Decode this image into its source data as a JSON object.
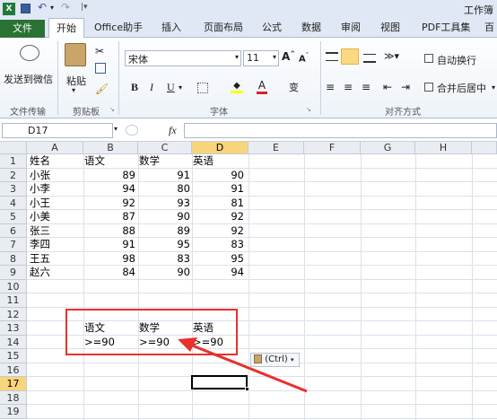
{
  "window": {
    "title": "工作簿"
  },
  "tabs": {
    "file": "文件",
    "home": "开始",
    "office": "Office助手",
    "insert": "插入",
    "layout": "页面布局",
    "formula": "公式",
    "data": "数据",
    "review": "审阅",
    "view": "视图",
    "pdf": "PDF工具集",
    "more": "百"
  },
  "ribbon": {
    "send_wechat": "发送到微信",
    "paste": "粘贴",
    "font_name": "宋体",
    "font_size": "11",
    "bold": "B",
    "italic": "I",
    "underline": "U",
    "wrap": "自动换行",
    "merge": "合并后居中",
    "groups": {
      "file_transfer": "文件传输",
      "clipboard": "剪贴板",
      "font": "字体",
      "alignment": "对齐方式"
    }
  },
  "formula_bar": {
    "name_box": "D17",
    "fx": "fx",
    "value": ""
  },
  "columns": [
    "A",
    "B",
    "C",
    "D",
    "E",
    "F",
    "G",
    "H"
  ],
  "rows": [
    "1",
    "2",
    "3",
    "4",
    "5",
    "6",
    "7",
    "8",
    "9",
    "10",
    "11",
    "12",
    "13",
    "14",
    "15",
    "16",
    "17",
    "18",
    "19"
  ],
  "table": {
    "headers": [
      "姓名",
      "语文",
      "数学",
      "英语"
    ],
    "rows": [
      [
        "小张",
        "89",
        "91",
        "90"
      ],
      [
        "小李",
        "94",
        "80",
        "91"
      ],
      [
        "小王",
        "92",
        "93",
        "81"
      ],
      [
        "小美",
        "87",
        "90",
        "92"
      ],
      [
        "张三",
        "88",
        "89",
        "92"
      ],
      [
        "李四",
        "91",
        "95",
        "83"
      ],
      [
        "王五",
        "98",
        "83",
        "95"
      ],
      [
        "赵六",
        "84",
        "90",
        "94"
      ]
    ]
  },
  "criteria": {
    "headers": [
      "语文",
      "数学",
      "英语"
    ],
    "values": [
      ">=90",
      ">=90",
      ">=90"
    ]
  },
  "paste_options": "(Ctrl)",
  "colors": {
    "accent_file": "#2a7233",
    "highlight": "#e8302d",
    "selected_header": "#f8d57a"
  }
}
